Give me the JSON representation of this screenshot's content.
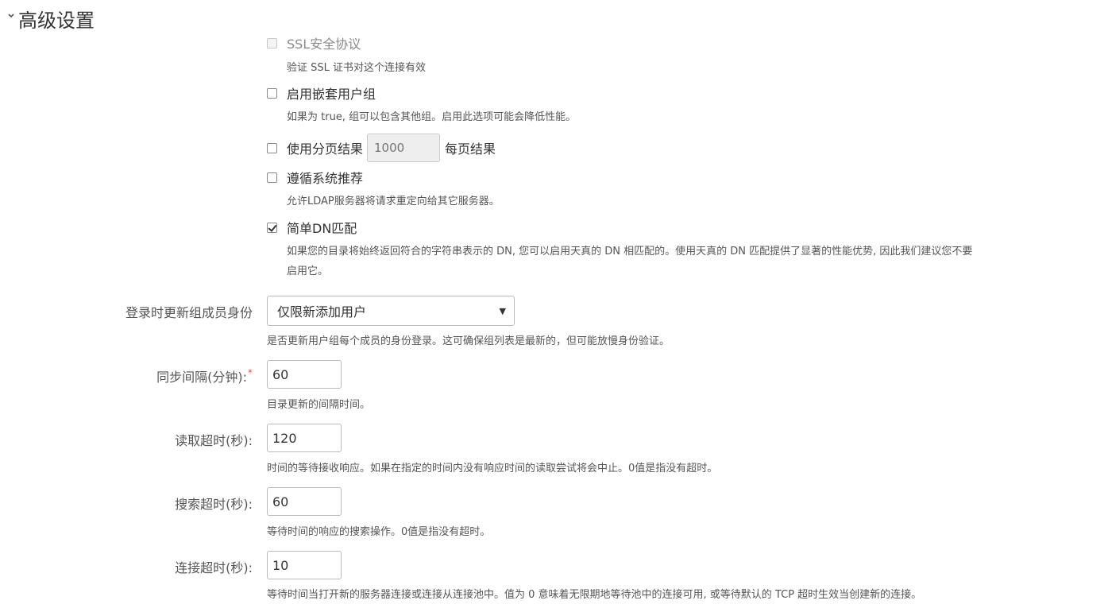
{
  "section": {
    "title": "高级设置"
  },
  "options": {
    "ssl": {
      "label": "SSL安全协议",
      "help": "验证 SSL 证书对这个连接有效",
      "checked": false,
      "disabled": true
    },
    "nested_groups": {
      "label": "启用嵌套用户组",
      "help": "如果为 true, 组可以包含其他组。启用此选项可能会降低性能。",
      "checked": false
    },
    "paged_results": {
      "label": "使用分页结果",
      "placeholder": "1000",
      "after": "每页结果",
      "checked": false
    },
    "referrals": {
      "label": "遵循系统推荐",
      "help": "允许LDAP服务器将请求重定向给其它服务器。",
      "checked": false
    },
    "naive_dn": {
      "label": "简单DN匹配",
      "help_line1": "如果您的目录将始终返回符合的字符串表示的 DN, 您可以启用天真的 DN 相匹配的。使用天真的 DN 匹配提供了显著的性能优势, 因此我们建议您不要",
      "help_line2": "启用它。",
      "checked": true
    }
  },
  "fields": {
    "update_membership": {
      "label": "登录时更新组成员身份",
      "value": "仅限新添加用户",
      "help": "是否更新用户组每个成员的身份登录。这可确保组列表是最新的，但可能放慢身份验证。"
    },
    "sync_interval": {
      "label": "同步间隔(分钟):",
      "required_mark": "*",
      "value": "60",
      "help": "目录更新的间隔时间。"
    },
    "read_timeout": {
      "label": "读取超时(秒):",
      "value": "120",
      "help": "时间的等待接收响应。如果在指定的时间内没有响应时间的读取尝试将会中止。0值是指没有超时。"
    },
    "search_timeout": {
      "label": "搜索超时(秒):",
      "value": "60",
      "help": "等待时间的响应的搜索操作。0值是指没有超时。"
    },
    "connection_timeout": {
      "label": "连接超时(秒):",
      "value": "10",
      "help": "等待时间当打开新的服务器连接或连接从连接池中。值为 0 意味着无限期地等待池中的连接可用, 或等待默认的 TCP 超时生效当创建新的连接。"
    }
  }
}
